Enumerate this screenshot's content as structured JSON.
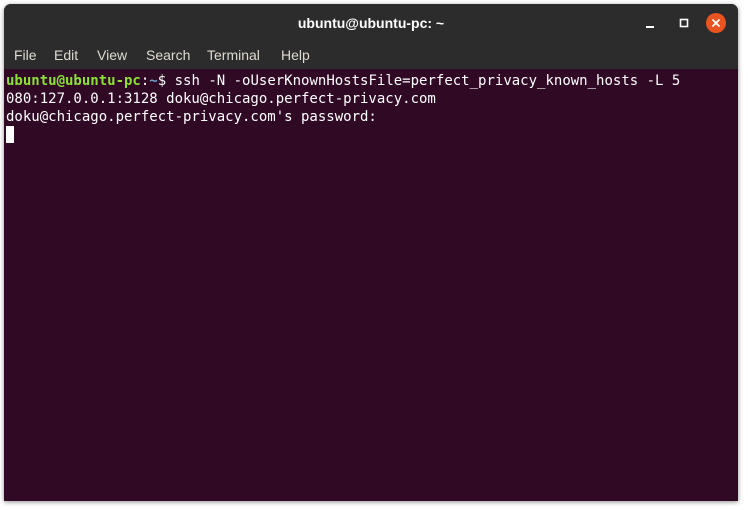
{
  "window": {
    "title": "ubuntu@ubuntu-pc: ~",
    "controls": {
      "minimize_icon": "minimize-icon",
      "maximize_icon": "maximize-icon",
      "close_icon": "close-icon"
    }
  },
  "menubar": {
    "items": [
      "File",
      "Edit",
      "View",
      "Search",
      "Terminal",
      "Help"
    ]
  },
  "terminal": {
    "prompt_user": "ubuntu@ubuntu-pc",
    "prompt_sep": ":",
    "prompt_path": "~",
    "prompt_symbol": "$",
    "command_part1": " ssh -N -oUserKnownHostsFile=perfect_privacy_known_hosts -L 5",
    "command_part2": "080:127.0.0.1:3128 doku@chicago.perfect-privacy.com",
    "password_prompt": "doku@chicago.perfect-privacy.com's password:"
  },
  "colors": {
    "terminal_bg": "#300a24",
    "titlebar_bg": "#2c2c2c",
    "prompt_user": "#8ae234",
    "prompt_path": "#729fcf",
    "close_button": "#e95420"
  }
}
